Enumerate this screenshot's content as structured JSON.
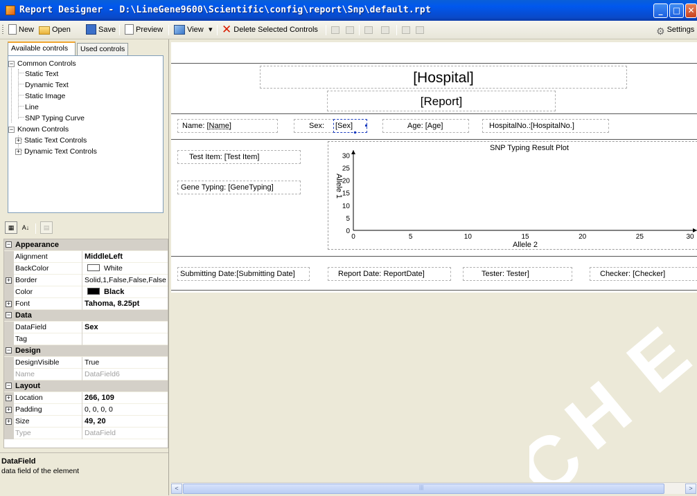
{
  "window": {
    "title": "Report Designer - D:\\LineGene9600\\Scientific\\config\\report\\Snp\\default.rpt",
    "minimize_glyph": "_",
    "maximize_glyph": "□",
    "close_glyph": "✕"
  },
  "toolbar": {
    "new_label": "New",
    "open_label": "Open",
    "save_label": "Save",
    "preview_label": "Preview",
    "view_label": "View",
    "view_dropdown_glyph": "▾",
    "delete_label": "Delete Selected Controls",
    "settings_label": "Settings"
  },
  "left_tabs": {
    "available": "Available controls",
    "used": "Used controls"
  },
  "tree": {
    "common_controls": "Common Controls",
    "static_text": "Static Text",
    "dynamic_text": "Dynamic Text",
    "static_image": "Static Image",
    "line": "Line",
    "snp_curve": "SNP Typing Curve",
    "known_controls": "Known Controls",
    "static_text_controls": "Static Text Controls",
    "dynamic_text_controls": "Dynamic Text Controls",
    "collapse_glyph": "−",
    "expand_glyph": "+"
  },
  "property_grid": {
    "appearance": "Appearance",
    "alignment_name": "Alignment",
    "alignment_val": "MiddleLeft",
    "backcolor_name": "BackColor",
    "backcolor_val": "White",
    "border_name": "Border",
    "border_val": "Solid,1,False,False,False",
    "color_name": "Color",
    "color_val": "Black",
    "font_name": "Font",
    "font_val": "Tahoma, 8.25pt",
    "data": "Data",
    "datafield_name": "DataField",
    "datafield_val": "Sex",
    "tag_name": "Tag",
    "tag_val": "",
    "design": "Design",
    "designvisible_name": "DesignVisible",
    "designvisible_val": "True",
    "name_name": "Name",
    "name_val": "DataField6",
    "layout": "Layout",
    "location_name": "Location",
    "location_val": "266, 109",
    "padding_name": "Padding",
    "padding_val": "0, 0, 0, 0",
    "size_name": "Size",
    "size_val": "49, 20",
    "type_name": "Type",
    "type_val": "DataField"
  },
  "help": {
    "title": "DataField",
    "description": "data field of the element"
  },
  "colors": {
    "titlebar": "#0058ee",
    "backcolor_swatch": "#ffffff",
    "color_swatch": "#000000",
    "selection": "#1a3cbf"
  },
  "report": {
    "hospital": "[Hospital]",
    "report": "[Report]",
    "name_label": "Name:",
    "name_field": "[Name]",
    "sex_label": "Sex:",
    "sex_field": "[Sex]",
    "age_label": "Age:",
    "age_field": "[Age]",
    "hospital_no_label": "HospitalNo.:",
    "hospital_no_field": "[HospitalNo.]",
    "test_item_label": "Test Item:",
    "test_item_field": "[Test Item]",
    "gene_typing_label": "Gene Typing:",
    "gene_typing_field": "[GeneTyping]",
    "submitting_label": "Submitting Date:",
    "submitting_field": "[Submitting Date]",
    "report_date_label": "Report Date:",
    "report_date_field": "ReportDate]",
    "tester_label": "Tester:",
    "tester_field": "Tester]",
    "checker_label": "Checker:",
    "checker_field": "[Checker]"
  },
  "scrollbar": {
    "left_glyph": "<",
    "right_glyph": ">",
    "thumb_glyph": "|||"
  },
  "chart_data": {
    "type": "scatter",
    "title": "SNP Typing Result Plot",
    "xlabel": "Allele 2",
    "ylabel": "Allele 1",
    "xlim": [
      0,
      30
    ],
    "ylim": [
      0,
      30
    ],
    "xticks": [
      0,
      5,
      10,
      15,
      20,
      25,
      30
    ],
    "yticks": [
      0,
      5,
      10,
      15,
      20,
      25,
      30
    ],
    "series": []
  }
}
